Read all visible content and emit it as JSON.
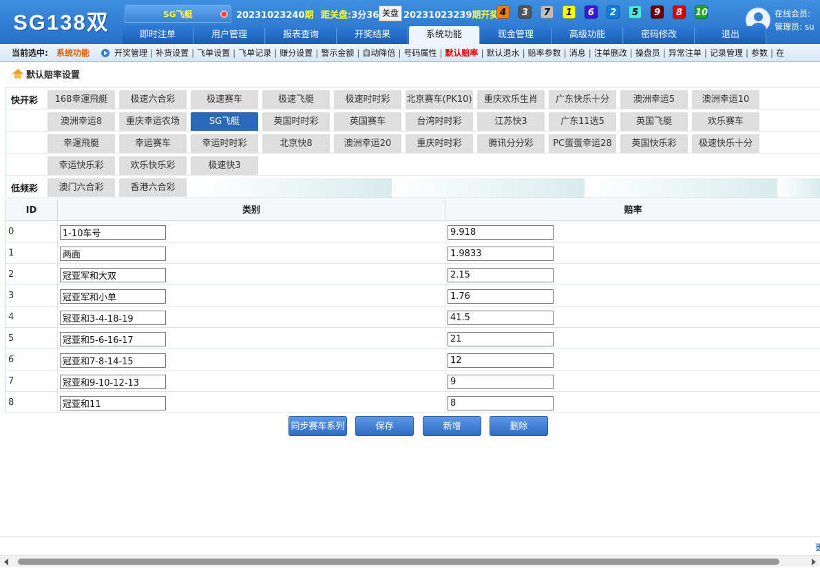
{
  "header": {
    "logo": "SG138双",
    "game_chip": "SG飞艇",
    "current_issue": "20231023240",
    "issue_suffix": "期",
    "close_label": "距关盘:",
    "countdown": "3分36秒",
    "close_button": "关盘",
    "last_issue": "20231023239",
    "draw_label": "期开奖:",
    "balls": [
      {
        "num": "4",
        "bg": "#f07d00",
        "fg": "#000000"
      },
      {
        "num": "3",
        "bg": "#555555",
        "fg": "#ffffff"
      },
      {
        "num": "7",
        "bg": "#bdbdbd",
        "fg": "#000000"
      },
      {
        "num": "1",
        "bg": "#ffff00",
        "fg": "#000000"
      },
      {
        "num": "6",
        "bg": "#3b18d8",
        "fg": "#ffffff"
      },
      {
        "num": "2",
        "bg": "#0f7de0",
        "fg": "#ffffff"
      },
      {
        "num": "5",
        "bg": "#49e6e6",
        "fg": "#000000"
      },
      {
        "num": "9",
        "bg": "#6b0000",
        "fg": "#ffffff"
      },
      {
        "num": "8",
        "bg": "#e60000",
        "fg": "#ffffff"
      },
      {
        "num": "10",
        "bg": "#1ea81e",
        "fg": "#ffffff"
      }
    ],
    "online_label": "在线会员:",
    "admin_label": "管理员:",
    "admin_value": "su"
  },
  "nav": [
    "即时注单",
    "用户管理",
    "报表查询",
    "开奖结果",
    "系统功能",
    "现金管理",
    "高级功能",
    "密码修改",
    "退出"
  ],
  "nav_active": "系统功能",
  "submenu": {
    "current_label": "当前选中:",
    "current_value": "系统功能",
    "links": [
      "开奖管理",
      "补货设置",
      "飞单设置",
      "飞单记录",
      "赚分设置",
      "警示金额",
      "自动降倍",
      "号码属性",
      "默认赔率",
      "默认退水",
      "赔率参数",
      "消息",
      "注单删改",
      "操盘员",
      "异常注单",
      "记录管理",
      "参数",
      "在"
    ],
    "active_link": "默认赔率"
  },
  "breadcrumb": "默认赔率设置",
  "lottery": {
    "fast_label": "快开彩",
    "slow_label": "低频彩",
    "rows": [
      [
        "168幸運飛艇",
        "极速六合彩",
        "极速赛车",
        "极速飞艇",
        "极速时时彩",
        "北京赛车(PK10)",
        "重庆欢乐生肖",
        "广东快乐十分",
        "澳洲幸运5",
        "澳洲幸运10"
      ],
      [
        "澳洲幸运8",
        "重庆幸运农场",
        "SG飞艇",
        "英国时时彩",
        "英国赛车",
        "台湾时时彩",
        "江苏快3",
        "广东11选5",
        "英国飞艇",
        "欢乐赛车"
      ],
      [
        "幸運飛艇",
        "幸运赛车",
        "幸运时时彩",
        "北京快8",
        "澳洲幸运20",
        "重庆时时彩",
        "腾讯分分彩",
        "PC蛋蛋幸运28",
        "英国快乐彩",
        "极速快乐十分"
      ],
      [
        "幸运快乐彩",
        "欢乐快乐彩",
        "极速快3"
      ]
    ],
    "slow_items": [
      "澳门六合彩",
      "香港六合彩"
    ],
    "active": "SG飞艇"
  },
  "table": {
    "headers": [
      "ID",
      "类别",
      "赔率"
    ],
    "rows": [
      {
        "id": "0",
        "category": "1-10车号",
        "odds": "9.918"
      },
      {
        "id": "1",
        "category": "两面",
        "odds": "1.9833"
      },
      {
        "id": "2",
        "category": "冠亚军和大双",
        "odds": "2.15"
      },
      {
        "id": "3",
        "category": "冠亚军和小单",
        "odds": "1.76"
      },
      {
        "id": "4",
        "category": "冠亚和3-4-18-19",
        "odds": "41.5"
      },
      {
        "id": "5",
        "category": "冠亚和5-6-16-17",
        "odds": "21"
      },
      {
        "id": "6",
        "category": "冠亚和7-8-14-15",
        "odds": "12"
      },
      {
        "id": "7",
        "category": "冠亚和9-10-12-13",
        "odds": "9"
      },
      {
        "id": "8",
        "category": "冠亚和11",
        "odds": "8"
      }
    ]
  },
  "actions": {
    "sync": "同步赛车系列",
    "save": "保存",
    "add": "新增",
    "delete": "删除"
  },
  "footer_text": "更"
}
